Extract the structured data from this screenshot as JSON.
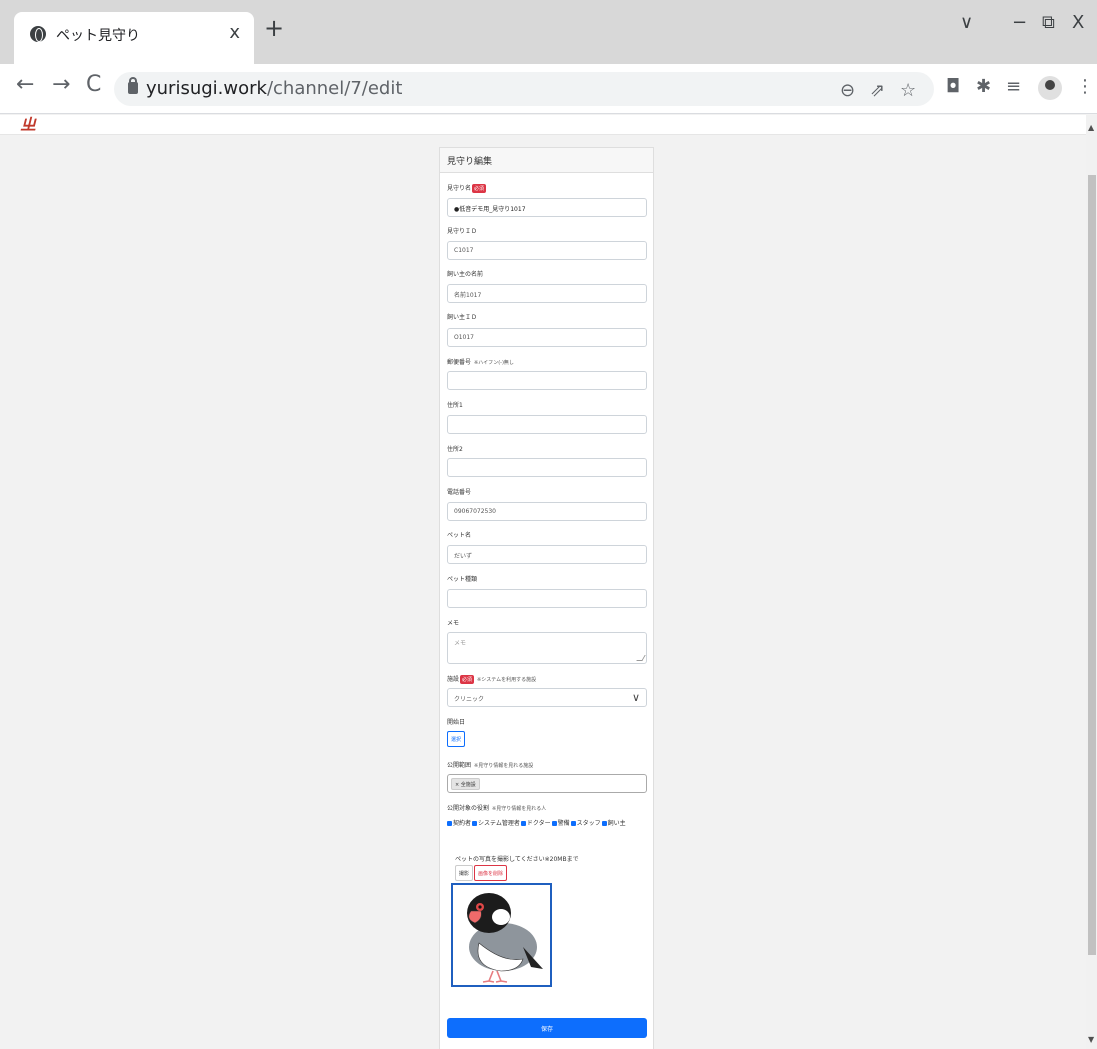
{
  "browser": {
    "tab_title": "ペット見守り",
    "tab_close": "x",
    "new_tab": "+",
    "window_controls": {
      "dropdown": "∨",
      "minimize": "−",
      "restore": "⧉",
      "close": "X"
    },
    "nav": {
      "back": "←",
      "forward": "→",
      "reload": "C"
    },
    "url_host": "yurisugi.work",
    "url_path": "/channel/7/edit",
    "toolbar_icons": [
      "zoom-icon",
      "share-icon",
      "star-icon",
      "camera-extension-icon",
      "puzzle-extension-icon",
      "reading-list-icon",
      "profile-avatar-icon",
      "menu-icon"
    ]
  },
  "form": {
    "header": "見守り編集",
    "required_badge": "必須",
    "fields": {
      "name_label": "見守り名",
      "name_value": "●低音デモ用_見守り1017",
      "id_label": "見守りＩＤ",
      "id_value": "C1017",
      "owner_name_label": "飼い主の名前",
      "owner_name_value": "名前1017",
      "owner_id_label": "飼い主ＩＤ",
      "owner_id_value": "O1017",
      "postal_label": "郵便番号",
      "postal_hint": "※ハイフン(-)無し",
      "address1_label": "住所1",
      "address2_label": "住所2",
      "phone_label": "電話番号",
      "phone_value": "09067072530",
      "pet_name_label": "ペット名",
      "pet_name_value": "だいず",
      "pet_type_label": "ペット種類",
      "memo_label": "メモ",
      "memo_placeholder": "メモ",
      "facility_label": "施設",
      "facility_hint": "※システムを利用する施設",
      "facility_value": "クリニック",
      "start_label": "開始日",
      "start_button": "選択",
      "scope_label": "公開範囲",
      "scope_hint": "※見守り情報を見れる施設",
      "scope_chip": "× 全施設",
      "role_label": "公開対象の役割",
      "role_hint": "※見守り情報を見れる人",
      "roles": [
        "契約者",
        "システム管理者",
        "ドクター",
        "警備",
        "スタッフ",
        "飼い主"
      ],
      "photo_note": "ペットの写真を撮影してください※20MBまで",
      "photo_capture": "撮影",
      "photo_delete": "画像を削除",
      "submit": "保存"
    }
  }
}
